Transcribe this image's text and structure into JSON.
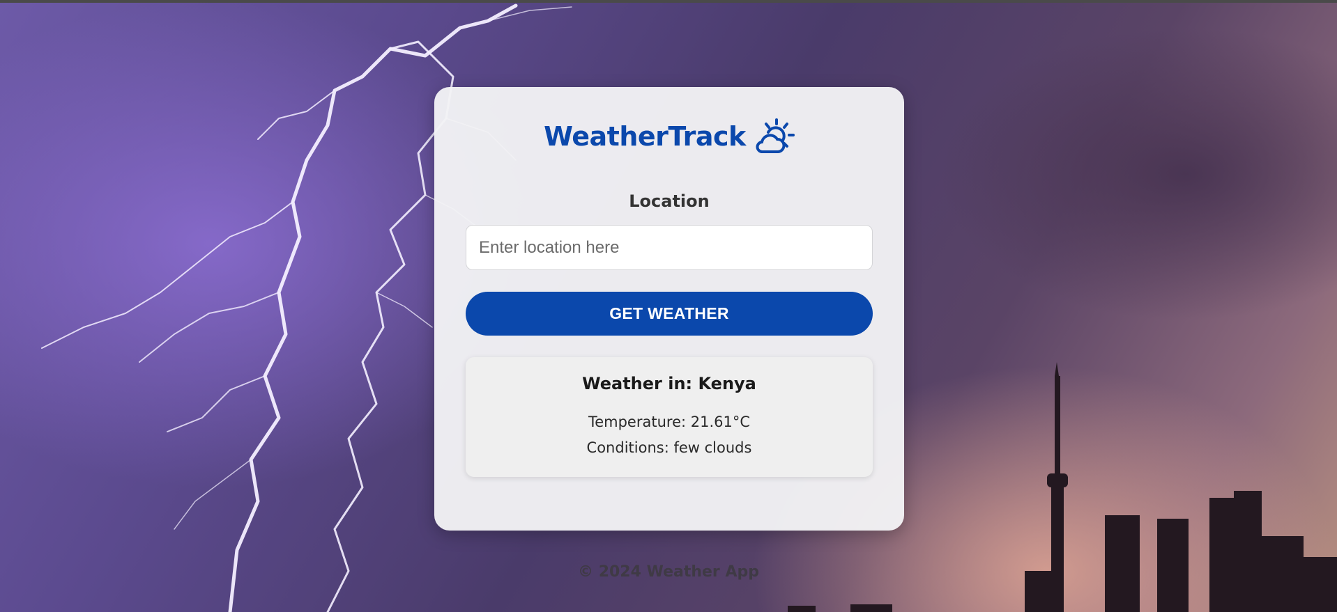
{
  "app": {
    "title": "WeatherTrack",
    "logo_icon": "sun-behind-cloud-icon",
    "brand_color": "#0b48ac"
  },
  "form": {
    "location_label": "Location",
    "location_value": "",
    "location_placeholder": "Enter location here",
    "submit_label": "GET WEATHER"
  },
  "result": {
    "heading": "Weather in: Kenya",
    "temperature": "Temperature: 21.61°C",
    "conditions": "Conditions: few clouds"
  },
  "footer": {
    "text": "© 2024 Weather App"
  },
  "background": {
    "description_icon": "lightning-city-skyline-image"
  }
}
